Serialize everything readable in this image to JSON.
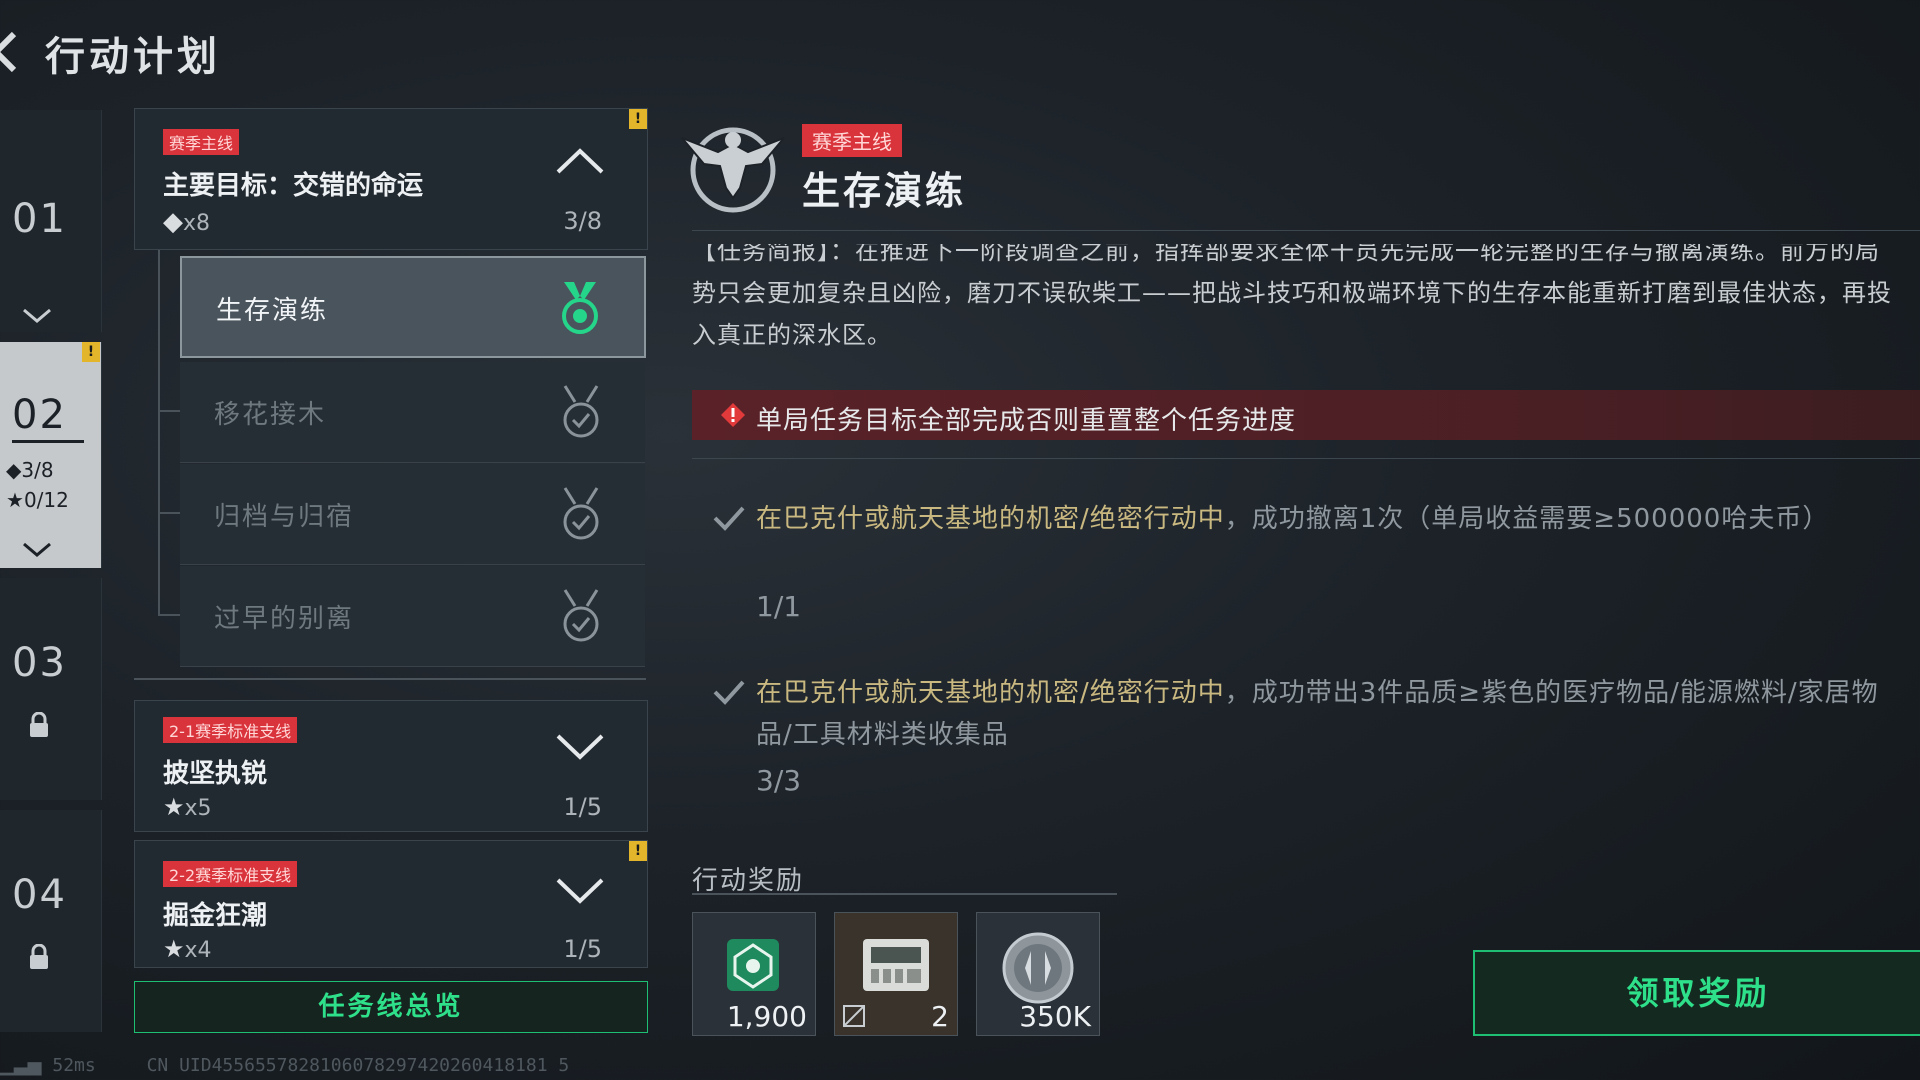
{
  "header": {
    "title": "行动计划"
  },
  "chapters": [
    {
      "num": "01"
    },
    {
      "num": "02",
      "diamond": "3/8",
      "star": "0/12"
    },
    {
      "num": "03"
    },
    {
      "num": "04"
    }
  ],
  "mission_main": {
    "tag": "赛季主线",
    "title": "主要目标：交错的命运",
    "reward": "x8",
    "progress": "3/8",
    "alert": "!"
  },
  "sub_missions": [
    {
      "label": "生存演练"
    },
    {
      "label": "移花接木"
    },
    {
      "label": "归档与归宿"
    },
    {
      "label": "过早的别离"
    }
  ],
  "mission_2_1": {
    "tag": "2-1赛季标准支线",
    "title": "披坚执锐",
    "reward": "x5",
    "progress": "1/5"
  },
  "mission_2_2": {
    "tag": "2-2赛季标准支线",
    "title": "掘金狂潮",
    "reward": "x4",
    "progress": "1/5",
    "alert": "!"
  },
  "overview_button": "任务线总览",
  "detail": {
    "tag": "赛季主线",
    "title": "生存演练",
    "description": "【任务简报】：在推进下一阶段调查之前，指挥部要求全体干员先完成一轮完整的生存与撤离演练。前方的局势只会更加复杂且凶险，磨刀不误砍柴工——把战斗技巧和极端环境下的生存本能重新打磨到最佳状态，再投入真正的深水区。",
    "warning": "单局任务目标全部完成否则重置整个任务进度",
    "objectives": [
      {
        "highlight": "在巴克什或航天基地的机密/绝密行动中",
        "text": "，成功撤离1次（单局收益需要≥500000哈夫币）",
        "progress": "1/1"
      },
      {
        "highlight": "在巴克什或航天基地的机密/绝密行动中",
        "text": "，成功带出3件品质≥紫色的医疗物品/能源燃料/家居物品/工具材料类收集品",
        "progress": "3/3"
      }
    ],
    "reward_label": "行动奖励",
    "rewards": [
      {
        "icon": "badge-icon",
        "qty": "1,900"
      },
      {
        "icon": "device-icon",
        "qty": "2"
      },
      {
        "icon": "coin-icon",
        "qty": "350K"
      }
    ],
    "claim_button": "领取奖励"
  },
  "status": {
    "ping": "52ms",
    "uid": "CN UID4556557828106078297420260418181 5"
  },
  "colors": {
    "accent_green": "#2fe08a",
    "tag_red": "#d9333b",
    "alert_yellow": "#e3b52a"
  }
}
